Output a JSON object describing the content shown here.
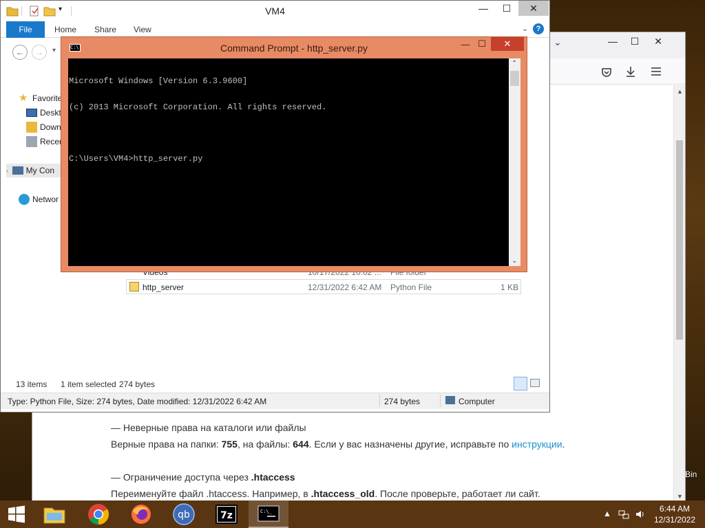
{
  "desktop": {
    "icon_label_partial": "e Bin"
  },
  "browser": {
    "article": {
      "item1_title": "— Неверные права на каталоги или файлы",
      "item1_text_a": "Верные права на папки: ",
      "item1_folders_perm": "755",
      "item1_text_b": ", на файлы: ",
      "item1_files_perm": "644",
      "item1_text_c": ". Если у вас назначены другие, исправьте по ",
      "item1_link": "инструкции",
      "item1_text_d": ".",
      "item2_title_a": "— Ограничение доступа через ",
      "item2_title_b": ".htaccess",
      "item2_text_a": "Переименуйте файл .htaccess. Например, в ",
      "item2_text_b": ".htaccess_old",
      "item2_text_c": ". После проверьте, работает ли сайт."
    }
  },
  "explorer": {
    "title": "VM4",
    "ribbon_tabs": [
      "File",
      "Home",
      "Share",
      "View"
    ],
    "sidebar": {
      "favorites": "Favorite",
      "desktop": "Deskt",
      "downloads": "Down",
      "recent": "Recen",
      "my_computer": "My Con",
      "network": "Networ"
    },
    "files": [
      {
        "name": "Videos",
        "date": "10/17/2022 10:02 ...",
        "type": "File folder",
        "size": ""
      },
      {
        "name": "http_server",
        "date": "12/31/2022 6:42 AM",
        "type": "Python File",
        "size": "1 KB"
      }
    ],
    "status": {
      "items": "13 items",
      "selected": "1 item selected",
      "bytes": "274 bytes"
    },
    "details": {
      "info": "Type: Python File, Size: 274 bytes, Date modified: 12/31/2022 6:42 AM",
      "size": "274 bytes",
      "location": "Computer"
    }
  },
  "cmd": {
    "title": "Command Prompt - http_server.py",
    "lines": [
      "Microsoft Windows [Version 6.3.9600]",
      "(c) 2013 Microsoft Corporation. All rights reserved.",
      "",
      "C:\\Users\\VM4>http_server.py"
    ]
  },
  "taskbar": {
    "items": [
      "file-explorer",
      "chrome",
      "firefox",
      "qbittorrent",
      "7-zip",
      "command-prompt"
    ],
    "time": "6:44 AM",
    "date": "12/31/2022"
  },
  "colors": {
    "cmd_frame": "#e88b65",
    "cmd_close": "#c7402c",
    "ribbon_file": "#1979ca",
    "taskbar": "#5a3512",
    "link": "#1a8fd0"
  }
}
